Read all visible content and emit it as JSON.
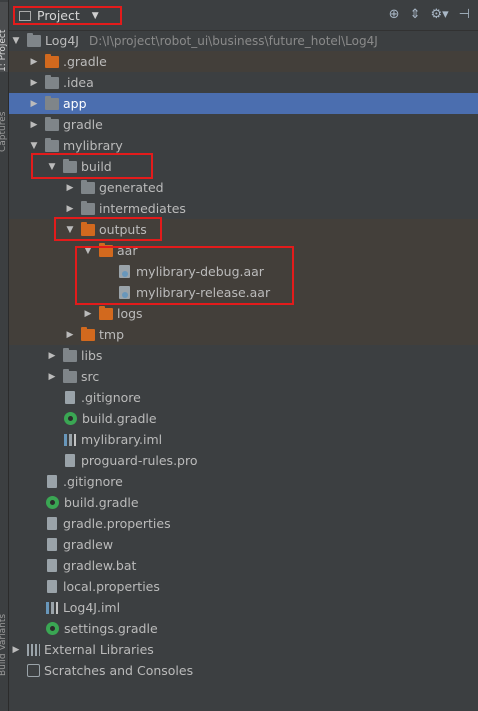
{
  "side_tabs": {
    "project": "1: Project",
    "captures": "Captures",
    "build_variants": "Build Variants"
  },
  "header": {
    "title": "Project",
    "icons": [
      "globe-icon",
      "collapse-icon",
      "settings-icon",
      "hide-icon"
    ]
  },
  "tree": [
    {
      "label": "Log4J",
      "path": "D:\\I\\project\\robot_ui\\business\\future_hotel\\Log4J",
      "icon": "folder-icon"
    },
    {
      "label": ".gradle",
      "icon": "folder-orange-icon"
    },
    {
      "label": ".idea",
      "icon": "folder-icon"
    },
    {
      "label": "app",
      "icon": "folder-icon"
    },
    {
      "label": "gradle",
      "icon": "folder-icon"
    },
    {
      "label": "mylibrary",
      "icon": "folder-icon"
    },
    {
      "label": "build",
      "icon": "folder-icon"
    },
    {
      "label": "generated",
      "icon": "folder-icon"
    },
    {
      "label": "intermediates",
      "icon": "folder-icon"
    },
    {
      "label": "outputs",
      "icon": "folder-orange-icon"
    },
    {
      "label": "aar",
      "icon": "folder-orange-icon"
    },
    {
      "label": "mylibrary-debug.aar",
      "icon": "aar-file-icon"
    },
    {
      "label": "mylibrary-release.aar",
      "icon": "aar-file-icon"
    },
    {
      "label": "logs",
      "icon": "folder-orange-icon"
    },
    {
      "label": "tmp",
      "icon": "folder-orange-icon"
    },
    {
      "label": "libs",
      "icon": "folder-icon"
    },
    {
      "label": "src",
      "icon": "folder-icon"
    },
    {
      "label": ".gitignore",
      "icon": "file-icon"
    },
    {
      "label": "build.gradle",
      "icon": "gradle-icon"
    },
    {
      "label": "mylibrary.iml",
      "icon": "iml-icon"
    },
    {
      "label": "proguard-rules.pro",
      "icon": "file-icon"
    },
    {
      "label": ".gitignore",
      "icon": "file-icon"
    },
    {
      "label": "build.gradle",
      "icon": "gradle-icon"
    },
    {
      "label": "gradle.properties",
      "icon": "file-icon"
    },
    {
      "label": "gradlew",
      "icon": "file-icon"
    },
    {
      "label": "gradlew.bat",
      "icon": "file-icon"
    },
    {
      "label": "local.properties",
      "icon": "file-icon"
    },
    {
      "label": "Log4J.iml",
      "icon": "iml-icon"
    },
    {
      "label": "settings.gradle",
      "icon": "gradle-icon"
    },
    {
      "label": "External Libraries",
      "icon": "library-icon"
    },
    {
      "label": "Scratches and Consoles",
      "icon": "scratch-icon"
    }
  ],
  "colors": {
    "background": "#3c3f41",
    "selection": "#4b6eaf",
    "highlight": "#433f3a",
    "annotation_box": "#e31b1b",
    "excluded_folder": "#d2691e"
  }
}
